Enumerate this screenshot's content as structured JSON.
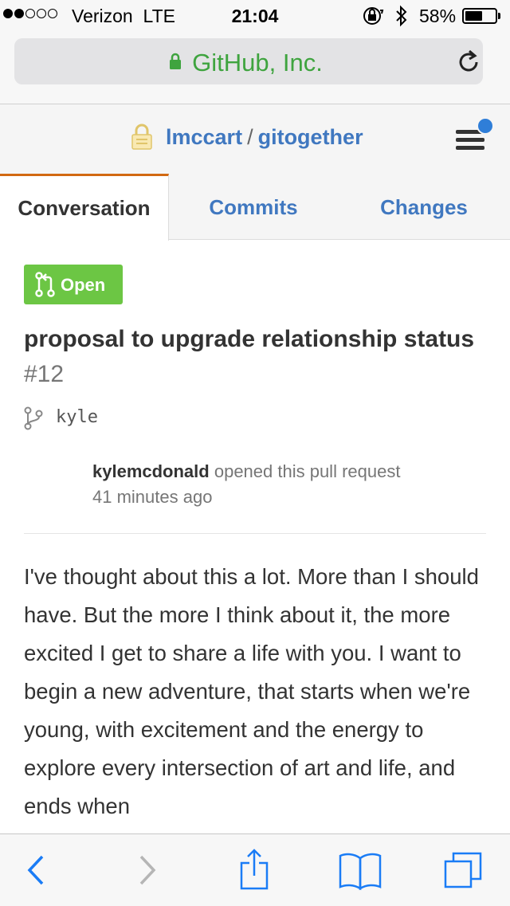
{
  "status_bar": {
    "carrier": "Verizon",
    "network": "LTE",
    "time": "21:04",
    "battery_pct": "58%",
    "battery_level": 0.58,
    "signal_bars": 2,
    "signal_total": 5
  },
  "browser": {
    "url_text": "GitHub, Inc.",
    "url_color": "#3fa43f"
  },
  "repo": {
    "owner": "lmccart",
    "separator": "/",
    "name": "gitogether"
  },
  "tabs": [
    {
      "label": "Conversation",
      "active": true
    },
    {
      "label": "Commits",
      "active": false
    },
    {
      "label": "Changes",
      "active": false
    }
  ],
  "pull_request": {
    "state": "Open",
    "state_color": "#6cc644",
    "title": "proposal to upgrade relationship status",
    "number": "#12",
    "branch": "kyle",
    "author": "kylemcdonald",
    "action": "opened this pull request",
    "time_ago": "41 minutes ago",
    "body": "I've thought about this a lot. More than I should have. But the more I think about it, the more excited I get to share a life with you. I want to begin a new adventure, that starts when we're young, with excitement and the energy to explore every intersection of art and life, and ends when"
  },
  "icons": {
    "status": [
      "rotation-lock-icon",
      "bluetooth-icon",
      "battery-icon"
    ],
    "toolbar": [
      "back-icon",
      "forward-icon",
      "share-icon",
      "bookmarks-icon",
      "tabs-icon"
    ]
  }
}
